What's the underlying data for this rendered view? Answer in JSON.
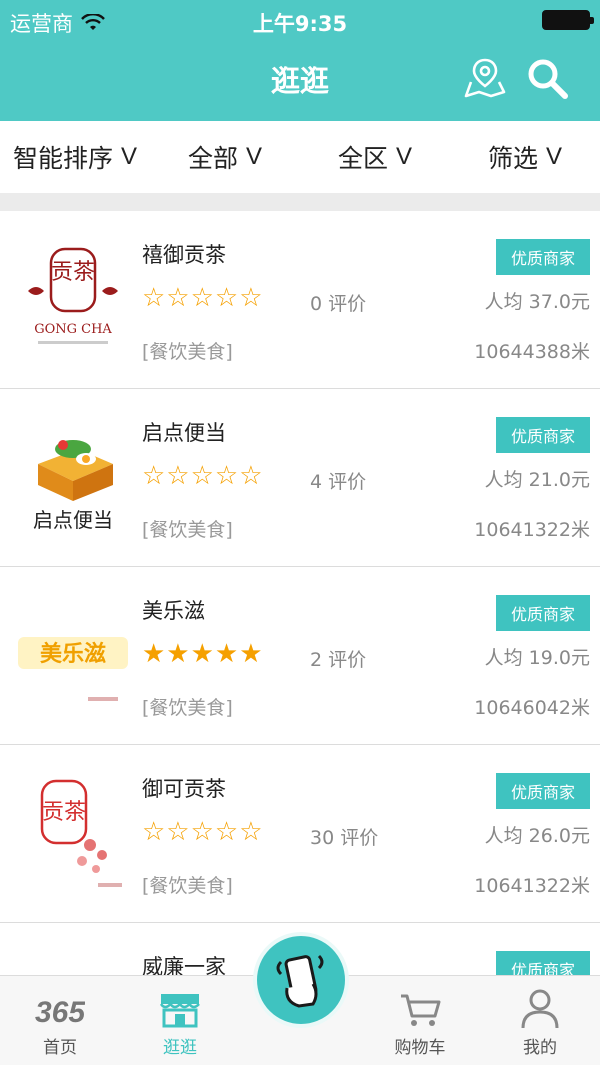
{
  "status_bar": {
    "carrier": "运营商",
    "time": "上午9:35"
  },
  "header": {
    "title": "逛逛"
  },
  "filters": [
    {
      "label": "智能排序",
      "arrow": "V"
    },
    {
      "label": "全部",
      "arrow": "V"
    },
    {
      "label": "全区",
      "arrow": "V"
    },
    {
      "label": "筛选",
      "arrow": "V"
    }
  ],
  "stores": [
    {
      "name": "禧御贡茶",
      "rating": 0,
      "stars": "☆☆☆☆☆",
      "reviews": "0 评价",
      "category": "[餐饮美食]",
      "badge": "优质商家",
      "price": "人均 37.0元",
      "distance": "10644388米",
      "logo_text": "贡茶",
      "logo_sub": "GONG CHA"
    },
    {
      "name": "启点便当",
      "rating": 0,
      "stars": "☆☆☆☆☆",
      "reviews": "4 评价",
      "category": "[餐饮美食]",
      "badge": "优质商家",
      "price": "人均 21.0元",
      "distance": "10641322米",
      "logo_text": "启点便当",
      "logo_sub": ""
    },
    {
      "name": "美乐滋",
      "rating": 5,
      "stars": "★★★★★",
      "reviews": "2 评价",
      "category": "[餐饮美食]",
      "badge": "优质商家",
      "price": "人均 19.0元",
      "distance": "10646042米",
      "logo_text": "美乐滋",
      "logo_sub": ""
    },
    {
      "name": "御可贡茶",
      "rating": 0,
      "stars": "☆☆☆☆☆",
      "reviews": "30 评价",
      "category": "[餐饮美食]",
      "badge": "优质商家",
      "price": "人均 26.0元",
      "distance": "10641322米",
      "logo_text": "贡茶",
      "logo_sub": ""
    },
    {
      "name": "威廉一家",
      "rating": 0,
      "stars": "",
      "reviews": "",
      "category": "",
      "badge": "优质商家",
      "price": "",
      "distance": "",
      "logo_text": "",
      "logo_sub": ""
    }
  ],
  "tabbar": {
    "home": {
      "label": "首页",
      "icon_text": "365"
    },
    "browse": {
      "label": "逛逛"
    },
    "cart": {
      "label": "购物车"
    },
    "me": {
      "label": "我的"
    }
  },
  "colors": {
    "primary": "#4fc9c5",
    "badge": "#3fc3c0",
    "star": "#f5a000"
  },
  "icons": [
    "wifi-icon",
    "battery-icon",
    "map-pin-icon",
    "search-icon",
    "home-icon",
    "shop-icon",
    "scan-phone-icon",
    "cart-icon",
    "user-icon"
  ]
}
